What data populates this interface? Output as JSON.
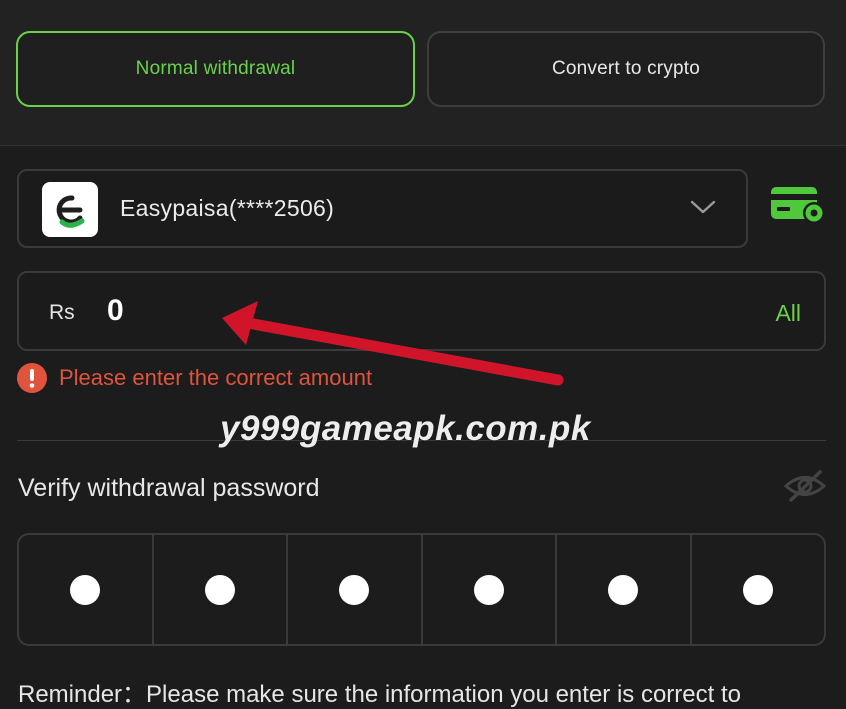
{
  "tabs": {
    "normal_label": "Normal withdrawal",
    "crypto_label": "Convert to crypto"
  },
  "account": {
    "label": "Easypaisa(****2506)",
    "logo_icon": "easypaisa-logo-icon",
    "chevron_icon": "chevron-down-icon",
    "settings_icon": "card-settings-icon"
  },
  "amount": {
    "currency": "Rs",
    "value": "0",
    "all_label": "All"
  },
  "error": {
    "icon": "alert-circle-icon",
    "message": "Please enter the correct amount"
  },
  "watermark": "y999gameapk.com.pk",
  "password": {
    "label": "Verify withdrawal password",
    "visibility_icon": "eye-off-icon",
    "digits_entered": 6
  },
  "reminder": "Reminder：Please make sure the information you enter is correct to",
  "colors": {
    "accent": "#6ad24a",
    "error": "#e0533c",
    "arrow": "#d0152a",
    "background": "#1c1c1c"
  }
}
